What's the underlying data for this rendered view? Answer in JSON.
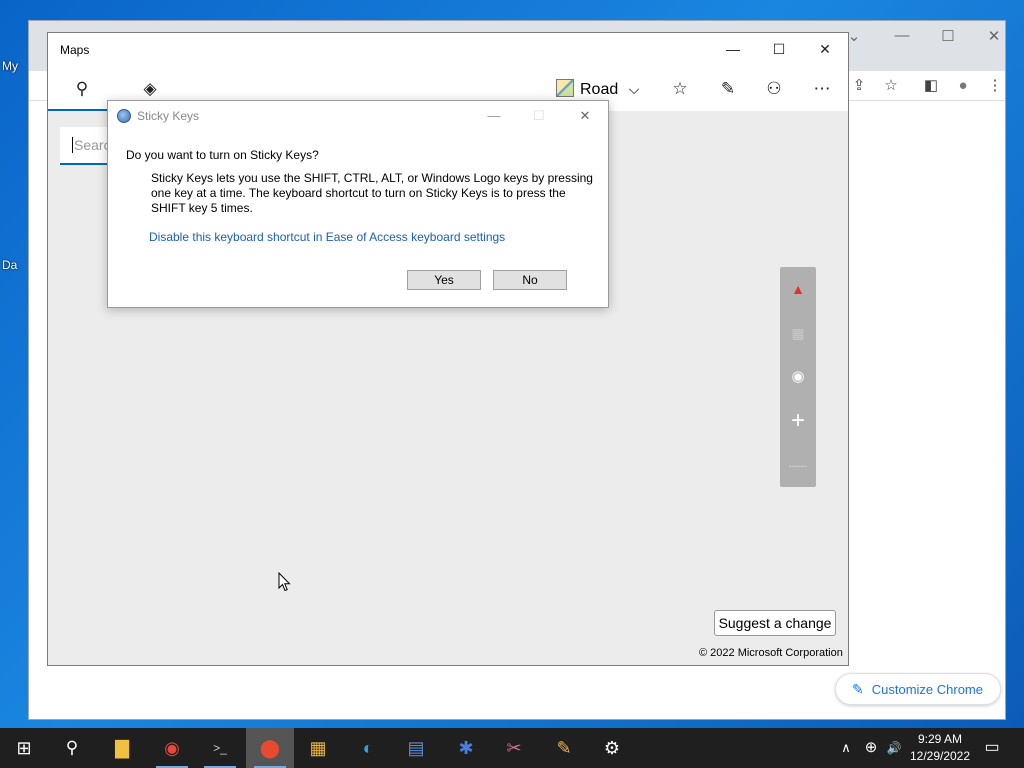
{
  "desktop": {
    "icon_label_fragments": [
      "My",
      "Da"
    ]
  },
  "maps": {
    "title": "Maps",
    "window_controls": {
      "minimize": "—",
      "maximize": "☐",
      "close": "✕"
    },
    "toolbar": {
      "search_icon": "⚲",
      "directions_icon": "◈",
      "map_style_label": "Road",
      "map_style_chevron": "⌵",
      "favorites_icon": "☆",
      "ink_icon": "✎",
      "account_icon": "⚇",
      "more_icon": "⋯"
    },
    "search": {
      "placeholder": "Searc"
    },
    "controls": {
      "compass_icon": "▲",
      "tilt_icon": "▦",
      "locate_icon": "◉",
      "zoom_in_icon": "+",
      "zoom_out_icon": "—"
    },
    "suggest_label": "Suggest a change",
    "copyright": "© 2022 Microsoft Corporation"
  },
  "sticky_keys": {
    "title": "Sticky Keys",
    "question": "Do you want to turn on Sticky Keys?",
    "description": "Sticky Keys lets you use the SHIFT, CTRL, ALT, or Windows Logo keys by pressing one key at a time. The keyboard shortcut to turn on Sticky Keys is to press the SHIFT key 5 times.",
    "link": "Disable this keyboard shortcut in Ease of Access keyboard settings",
    "yes_label": "Yes",
    "no_label": "No",
    "window_controls": {
      "minimize": "—",
      "maximize": "☐",
      "close": "✕"
    }
  },
  "chrome": {
    "window_controls": {
      "dropdown": "⌄",
      "minimize": "—",
      "maximize": "☐",
      "close": "✕"
    },
    "toolbar_icons": {
      "share": "⇪",
      "bookmark": "☆",
      "sidepanel": "◧",
      "profile": "●",
      "menu": "⋮"
    },
    "customize_label": "Customize Chrome",
    "customize_icon": "✎"
  },
  "taskbar": {
    "start_icon": "⊞",
    "search_icon": "⚲",
    "apps": [
      {
        "name": "file-explorer",
        "glyph": "▇",
        "color": "#f0c040"
      },
      {
        "name": "chrome",
        "glyph": "◉",
        "color": "#e8453c"
      },
      {
        "name": "terminal",
        "glyph": ">_",
        "color": "#cccccc"
      },
      {
        "name": "maps",
        "glyph": "⬤",
        "color": "#e84a2f"
      },
      {
        "name": "store",
        "glyph": "▦",
        "color": "#f2b233"
      },
      {
        "name": "edge",
        "glyph": "◐",
        "color": "#2fa0e0"
      },
      {
        "name": "calculator",
        "glyph": "▤",
        "color": "#5a8fd8"
      },
      {
        "name": "settings-app",
        "glyph": "✱",
        "color": "#4a7ed8"
      },
      {
        "name": "paint-3d",
        "glyph": "✂",
        "color": "#d86fa0"
      },
      {
        "name": "paint",
        "glyph": "✎",
        "color": "#e6b84a"
      },
      {
        "name": "settings",
        "glyph": "⚙",
        "color": "#ffffff"
      }
    ],
    "tray": {
      "chevron": "∧",
      "network": "⊕",
      "volume": "🔊",
      "notifications": "▭"
    },
    "time": "9:29 AM",
    "date": "12/29/2022"
  }
}
